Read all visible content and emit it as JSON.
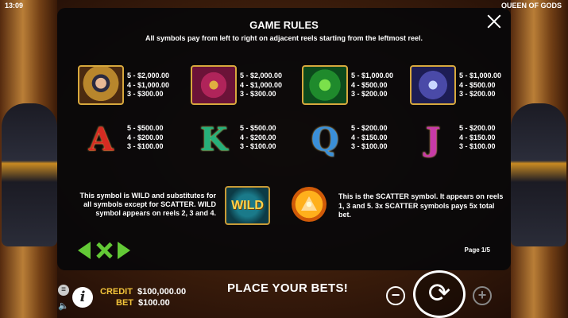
{
  "topbar": {
    "clock": "13:09",
    "game_title": "QUEEN OF GODS"
  },
  "dialog": {
    "title": "GAME RULES",
    "subtitle": "All symbols pay from left to right on adjacent reels starting from the leftmost reel.",
    "page": "Page 1/5"
  },
  "premium_symbols": [
    {
      "name": "queen",
      "pays": "5 - $2,000.00\n4 - $1,000.00\n3 - $300.00"
    },
    {
      "name": "horus",
      "pays": "5 - $2,000.00\n4 - $1,000.00\n3 - $300.00"
    },
    {
      "name": "snake",
      "pays": "5 - $1,000.00\n4 - $500.00\n3 - $200.00"
    },
    {
      "name": "anubis",
      "pays": "5 - $1,000.00\n4 - $500.00\n3 - $200.00"
    }
  ],
  "letter_symbols": [
    {
      "letter": "A",
      "pays": "5 - $500.00\n4 - $200.00\n3 - $100.00"
    },
    {
      "letter": "K",
      "pays": "5 - $500.00\n4 - $200.00\n3 - $100.00"
    },
    {
      "letter": "Q",
      "pays": "5 - $200.00\n4 - $150.00\n3 - $100.00"
    },
    {
      "letter": "J",
      "pays": "5 - $200.00\n4 - $150.00\n3 - $100.00"
    }
  ],
  "wild": {
    "label": "WILD",
    "text": "This symbol is WILD and substitutes for all symbols except for SCATTER. WILD symbol appears on reels 2, 3 and 4."
  },
  "scatter": {
    "text": "This is the SCATTER symbol. It appears on reels 1, 3 and 5. 3x SCATTER symbols pays 5x total bet."
  },
  "footer": {
    "credit_label": "CREDIT",
    "credit_value": "$100,000.00",
    "bet_label": "BET",
    "bet_value": "$100.00",
    "message": "PLACE YOUR BETS!"
  },
  "icons": {
    "menu": "menu-icon",
    "sound": "sound-icon",
    "info": "info-icon",
    "minus": "minus-icon",
    "spin": "spin-icon",
    "plus": "plus-icon",
    "close": "close-icon"
  }
}
